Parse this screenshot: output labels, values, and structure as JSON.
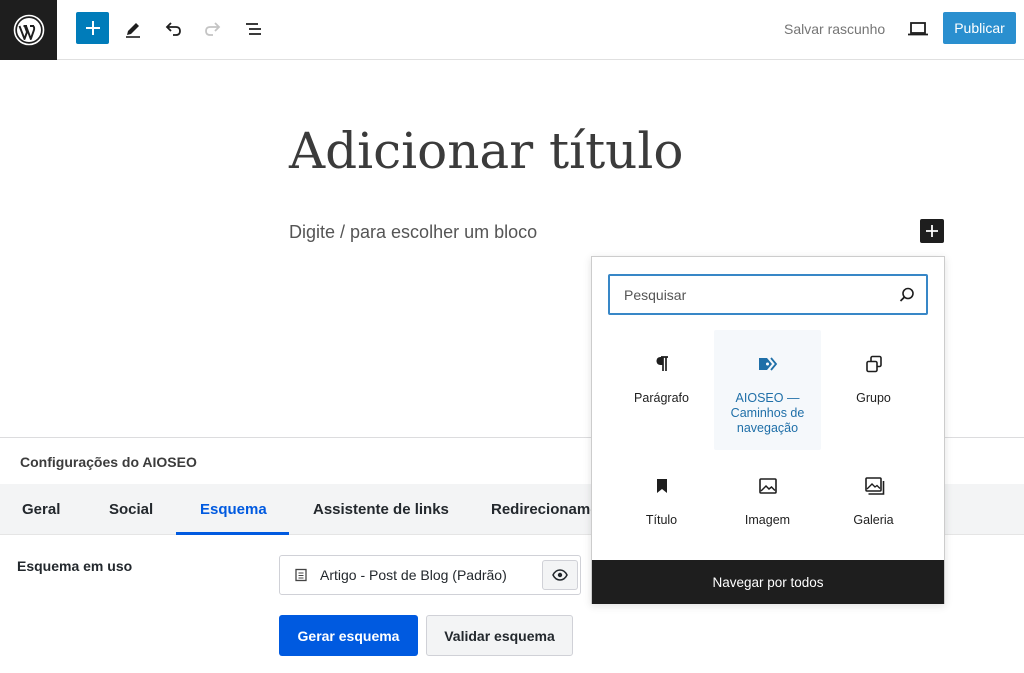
{
  "toolbar": {
    "save_draft": "Salvar rascunho",
    "publish": "Publicar"
  },
  "editor": {
    "title_placeholder": "Adicionar título",
    "block_hint": "Digite / para escolher um bloco"
  },
  "inserter": {
    "search_placeholder": "Pesquisar",
    "blocks": [
      {
        "label": "Parágrafo",
        "icon": "paragraph-icon"
      },
      {
        "label": "AIOSEO — Caminhos de navegação",
        "icon": "breadcrumb-tag-icon",
        "selected": true
      },
      {
        "label": "Grupo",
        "icon": "group-icon"
      },
      {
        "label": "Título",
        "icon": "bookmark-icon"
      },
      {
        "label": "Imagem",
        "icon": "image-icon"
      },
      {
        "label": "Galeria",
        "icon": "gallery-icon"
      }
    ],
    "browse_all": "Navegar por todos"
  },
  "aioseo": {
    "title": "Configurações do AIOSEO",
    "tabs": [
      {
        "label": "Geral"
      },
      {
        "label": "Social"
      },
      {
        "label": "Esquema",
        "active": true
      },
      {
        "label": "Assistente de links"
      },
      {
        "label": "Redirecioname"
      }
    ],
    "schema_label": "Esquema em uso",
    "schema_value": "Artigo - Post de Blog (Padrão)",
    "generate": "Gerar esquema",
    "validate": "Validar esquema"
  },
  "colors": {
    "primary": "#007cba",
    "aioseo_blue": "#005ae0",
    "dark": "#1e1e1e"
  }
}
